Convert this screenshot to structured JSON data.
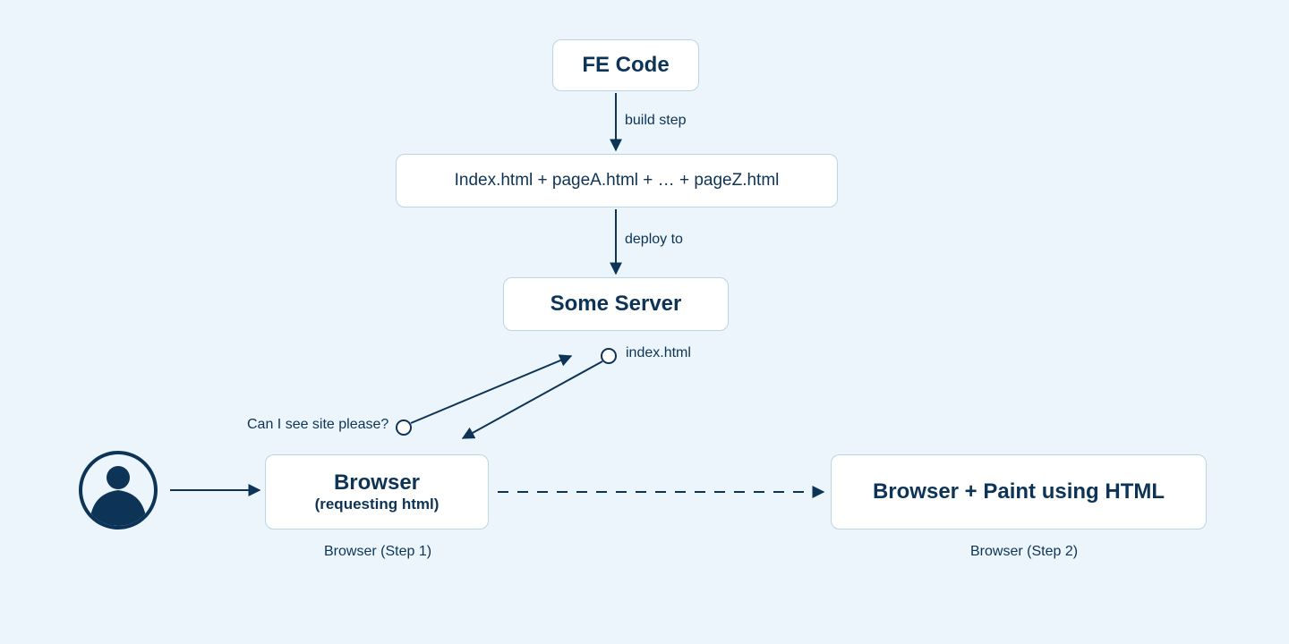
{
  "nodes": {
    "fe_code": "FE Code",
    "pages": "Index.html + pageA.html + … + pageZ.html",
    "server": "Some Server",
    "browser1_line1": "Browser",
    "browser1_line2": "(requesting html)",
    "browser2": "Browser + Paint using HTML"
  },
  "edges": {
    "build_step": "build step",
    "deploy_to": "deploy to",
    "request": "Can I see site please?",
    "response": "index.html"
  },
  "captions": {
    "step1": "Browser (Step 1)",
    "step2": "Browser (Step 2)"
  },
  "colors": {
    "bg": "#ebf5fb",
    "node_border": "#b9d6e6",
    "text": "#0d3456",
    "stroke": "#0d3456",
    "user_fill": "#0d3456"
  }
}
